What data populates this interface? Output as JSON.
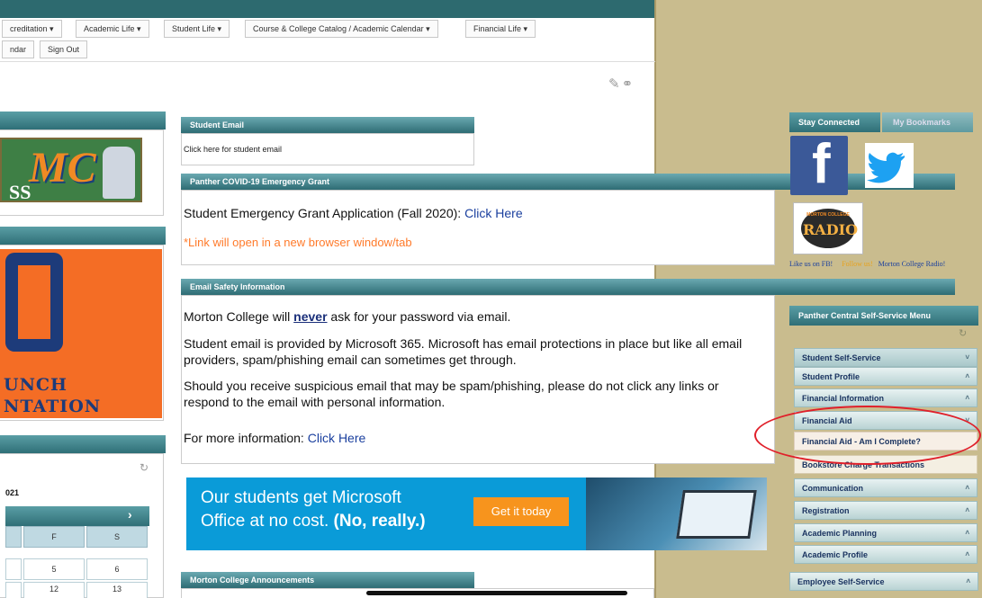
{
  "nav": {
    "row1": [
      "creditation ▾",
      "Academic Life ▾",
      "Student Life ▾",
      "Course & College Catalog / Academic Calendar ▾",
      "Financial Life ▾"
    ],
    "row2": [
      "ndar",
      "Sign Out"
    ]
  },
  "left": {
    "logo_text": "MC",
    "logo_sub": "SS",
    "banner_line1": "UNCH",
    "banner_line2": "NTATION",
    "calendar_year": "021",
    "calendar_next": "›",
    "calendar_days": [
      "F",
      "S"
    ],
    "calendar_row1": [
      "5",
      "6"
    ],
    "calendar_row2": [
      "12",
      "13"
    ],
    "refresh_icon": "↻"
  },
  "center": {
    "student_email": {
      "title": "Student Email",
      "link": "Click here for student email"
    },
    "covid": {
      "title": "Panther COVID-19 Emergency Grant",
      "text": "Student Emergency Grant Application (Fall 2020):",
      "link": "Click Here",
      "note": "*Link will open in a new browser window/tab"
    },
    "safety": {
      "title": "Email Safety Information",
      "p1_before": "Morton College will ",
      "p1_strong": "never",
      "p1_after": " ask for your password via email.",
      "p2": "Student email is provided by Microsoft 365. Microsoft has email protections in place but like all email providers, spam/phishing email can sometimes get through.",
      "p3": "Should you receive suspicious email that may be spam/phishing, please do not click any links or respond to the email with personal information.",
      "p4_before": "For more information: ",
      "p4_link": "Click Here"
    },
    "office_ad": {
      "line1": "Our students get Microsoft",
      "line2_before": "Office at no cost. ",
      "line2_bold": "(No, really.)",
      "button": "Get it today"
    },
    "announcements": {
      "title": "Morton College Announcements"
    }
  },
  "right": {
    "tabs": [
      "Stay Connected",
      "My Bookmarks"
    ],
    "facebook_glyph": "f",
    "radio_top": "MORTON COLLEGE",
    "radio_main": "RADIO",
    "social_caption": {
      "like": "Like us on FB!",
      "follow": "Follow us!",
      "radio": "Morton College Radio!"
    },
    "menu_title": "Panther Central Self-Service Menu",
    "menu_items": [
      {
        "label": "Student Self-Service",
        "arrow": "˅"
      },
      {
        "label": "Student Profile",
        "arrow": "˄"
      },
      {
        "label": "Financial Information",
        "arrow": "˄"
      },
      {
        "label": "Financial Aid",
        "arrow": "˅"
      },
      {
        "label": "Financial Aid - Am I Complete?",
        "arrow": ""
      },
      {
        "label": "Bookstore Charge Transactions",
        "arrow": ""
      },
      {
        "label": "Communication",
        "arrow": "˄"
      },
      {
        "label": "Registration",
        "arrow": "˄"
      },
      {
        "label": "Academic Planning",
        "arrow": "˄"
      },
      {
        "label": "Academic Profile",
        "arrow": "˄"
      },
      {
        "label": "Employee Self-Service",
        "arrow": "˄"
      }
    ]
  },
  "colors": {
    "header_teal": "#2f6f77",
    "tan_panel": "#c9bc8e",
    "highlight_circle": "#e0202a",
    "office_blue": "#0a9bd8",
    "office_button": "#f7941d"
  }
}
